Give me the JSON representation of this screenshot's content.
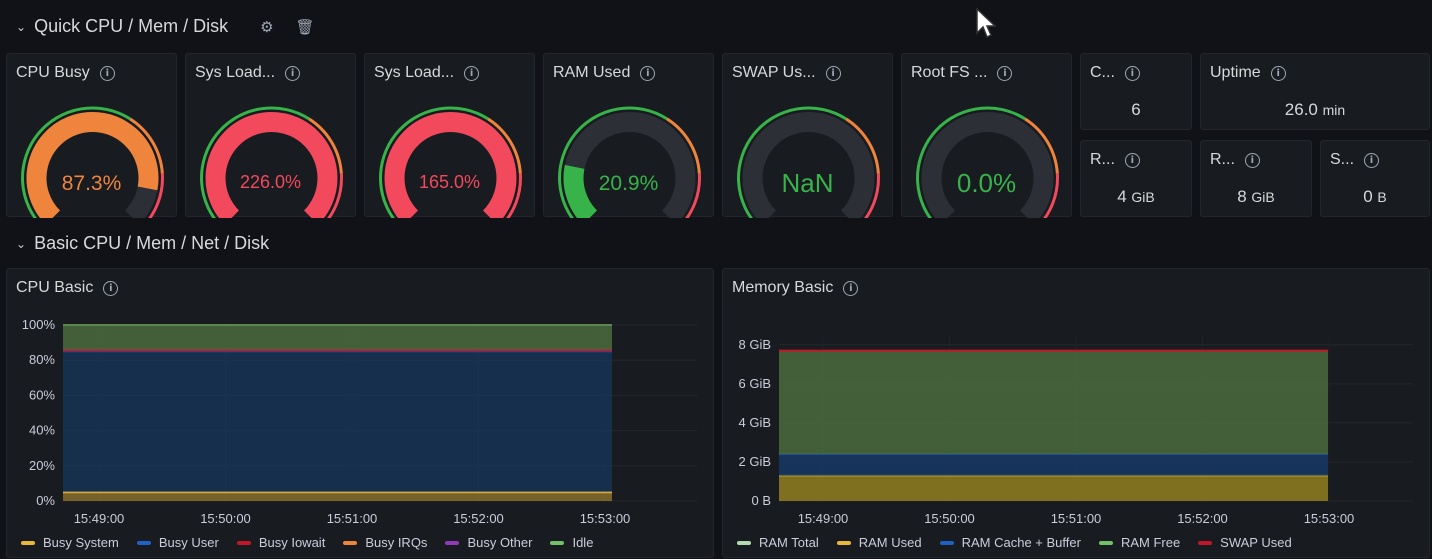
{
  "rows": {
    "quick": {
      "title": "Quick CPU / Mem / Disk"
    },
    "basic": {
      "title": "Basic CPU / Mem / Net / Disk"
    }
  },
  "icons": {
    "chevron": "chevron-down-icon",
    "settings": "gear-icon",
    "delete": "trash-icon",
    "info": "info-icon"
  },
  "gauges": [
    {
      "title": "CPU Busy",
      "value": "87.3%",
      "fraction": 0.873,
      "fill_color": "#ef843c",
      "text_color": "#ef843c"
    },
    {
      "title": "Sys Load...",
      "value": "226.0%",
      "fraction": 1.0,
      "fill_color": "#f2495c",
      "text_color": "#f2495c"
    },
    {
      "title": "Sys Load...",
      "value": "165.0%",
      "fraction": 1.0,
      "fill_color": "#f2495c",
      "text_color": "#f2495c"
    },
    {
      "title": "RAM Used",
      "value": "20.9%",
      "fraction": 0.209,
      "fill_color": "#37b34a",
      "text_color": "#37b34a"
    },
    {
      "title": "SWAP Us...",
      "value": "NaN",
      "fraction": 0,
      "fill_color": "#37b34a",
      "text_color": "#37b34a"
    },
    {
      "title": "Root FS ...",
      "value": "0.0%",
      "fraction": 0,
      "fill_color": "#37b34a",
      "text_color": "#37b34a"
    }
  ],
  "stats": {
    "cores": {
      "title": "C...",
      "value": "6",
      "unit": ""
    },
    "uptime": {
      "title": "Uptime",
      "value": "26.0",
      "unit": "min"
    },
    "ram_total": {
      "title": "R...",
      "value": "4",
      "unit": "GiB"
    },
    "swap_total": {
      "title": "R...",
      "value": "8",
      "unit": "GiB"
    },
    "swap": {
      "title": "S...",
      "value": "0",
      "unit": "B"
    }
  },
  "cpu_panel": {
    "title": "CPU Basic"
  },
  "memory_panel": {
    "title": "Memory Basic"
  },
  "colors": {
    "busy_system": "#eab839",
    "busy_user": "#1f60c4",
    "busy_iowait": "#c4162a",
    "busy_irqs": "#ef843c",
    "busy_other": "#8f3bb8",
    "idle": "#73bf69",
    "ram_total": "#b4dbb0",
    "ram_used": "#eab839",
    "ram_cache": "#1f60c4",
    "ram_free": "#73bf69",
    "swap_used": "#c4162a"
  },
  "chart_data": [
    {
      "type": "area",
      "title": "CPU Basic",
      "x": [
        "15:49:00",
        "15:50:00",
        "15:51:00",
        "15:52:00",
        "15:53:00"
      ],
      "y_ticks": [
        "100%",
        "80%",
        "60%",
        "40%",
        "20%",
        "0%"
      ],
      "ylim": [
        0,
        100
      ],
      "series": [
        {
          "name": "Busy System",
          "values": [
            5,
            5,
            5,
            5,
            5
          ]
        },
        {
          "name": "Busy User",
          "values": [
            80,
            80,
            80,
            80,
            80
          ]
        },
        {
          "name": "Busy Iowait",
          "values": [
            1,
            1,
            1,
            1,
            1
          ]
        },
        {
          "name": "Busy IRQs",
          "values": [
            0,
            0,
            0,
            0,
            0
          ]
        },
        {
          "name": "Busy Other",
          "values": [
            0,
            0,
            0,
            0,
            0
          ]
        },
        {
          "name": "Idle",
          "values": [
            14,
            14,
            14,
            14,
            14
          ]
        }
      ]
    },
    {
      "type": "area",
      "title": "Memory Basic",
      "x": [
        "15:49:00",
        "15:50:00",
        "15:51:00",
        "15:52:00",
        "15:53:00"
      ],
      "y_ticks": [
        "8 GiB",
        "6 GiB",
        "4 GiB",
        "2 GiB",
        "0 B"
      ],
      "ylim": [
        0,
        8.5
      ],
      "series": [
        {
          "name": "RAM Total",
          "values": [
            7.7,
            7.7,
            7.7,
            7.7,
            7.7
          ]
        },
        {
          "name": "RAM Used",
          "values": [
            1.3,
            1.3,
            1.3,
            1.3,
            1.3
          ]
        },
        {
          "name": "RAM Cache + Buffer",
          "values": [
            1.1,
            1.1,
            1.1,
            1.1,
            1.1
          ]
        },
        {
          "name": "RAM Free",
          "values": [
            5.3,
            5.3,
            5.3,
            5.3,
            5.3
          ]
        },
        {
          "name": "SWAP Used",
          "values": [
            0,
            0,
            0,
            0,
            0
          ]
        }
      ]
    }
  ]
}
